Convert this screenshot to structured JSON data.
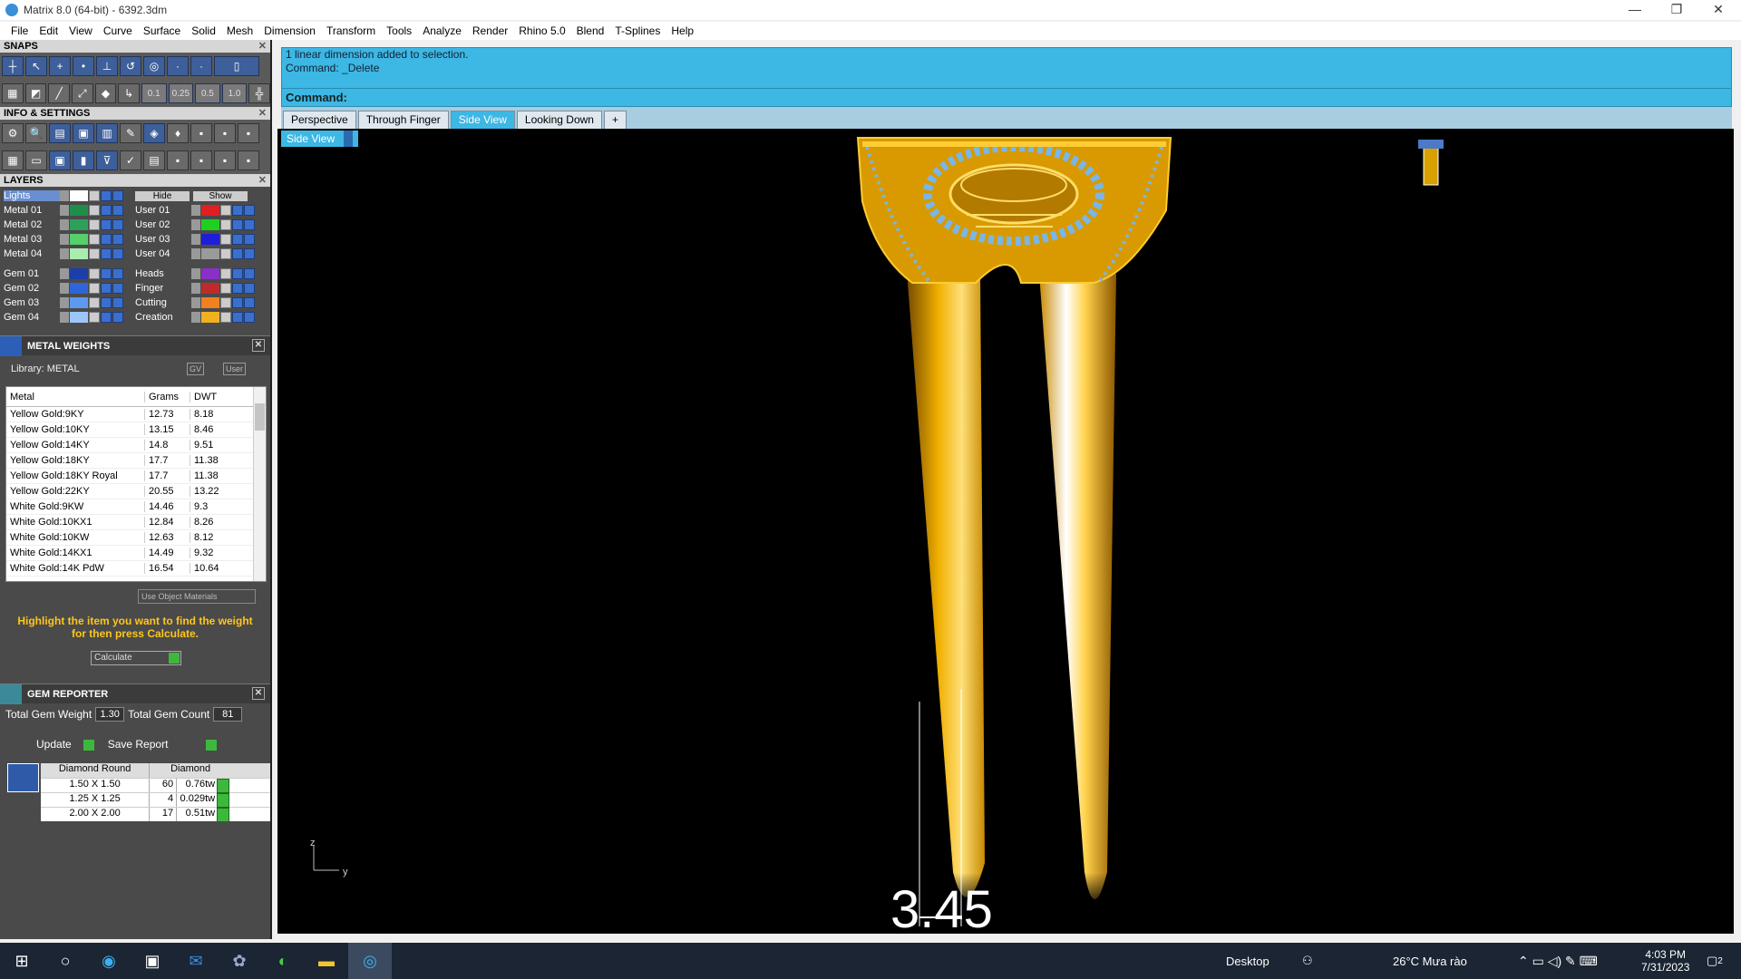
{
  "window": {
    "title": "Matrix 8.0 (64-bit) - 6392.3dm",
    "minimize": "—",
    "maximize": "❐",
    "close": "✕"
  },
  "menu": [
    "File",
    "Edit",
    "View",
    "Curve",
    "Surface",
    "Solid",
    "Mesh",
    "Dimension",
    "Transform",
    "Tools",
    "Analyze",
    "Render",
    "Rhino 5.0",
    "Blend",
    "T-Splines",
    "Help"
  ],
  "snaps": {
    "title": "SNAPS",
    "values": [
      "0.1",
      "0.25",
      "0.5",
      "1.0"
    ]
  },
  "info_settings": {
    "title": "INFO & SETTINGS"
  },
  "layers": {
    "title": "LAYERS",
    "lights": "Lights",
    "hide": "Hide",
    "show": "Show",
    "left": [
      {
        "name": "Metal 01",
        "color": "#1e8f4a"
      },
      {
        "name": "Metal 02",
        "color": "#2ea05a"
      },
      {
        "name": "Metal 03",
        "color": "#55d06a"
      },
      {
        "name": "Metal 04",
        "color": "#a8ecb0"
      },
      {
        "name": "Gem 01",
        "color": "#1a3fa8"
      },
      {
        "name": "Gem 02",
        "color": "#2e66d8"
      },
      {
        "name": "Gem 03",
        "color": "#5c9af0"
      },
      {
        "name": "Gem 04",
        "color": "#9cc6f8"
      }
    ],
    "right": [
      {
        "name": "User 01",
        "color": "#e02020"
      },
      {
        "name": "User 02",
        "color": "#20d020"
      },
      {
        "name": "User 03",
        "color": "#1e1ed8"
      },
      {
        "name": "User 04",
        "color": "#9a9a9a"
      },
      {
        "name": "Heads",
        "color": "#8a2fc8"
      },
      {
        "name": "Finger",
        "color": "#c02a2a"
      },
      {
        "name": "Cutting",
        "color": "#f08020"
      },
      {
        "name": "Creation",
        "color": "#f0b020"
      }
    ]
  },
  "metal_weights": {
    "title": "METAL WEIGHTS",
    "library": "Library: METAL",
    "gv": "GV",
    "user": "User",
    "columns": [
      "Metal",
      "Grams",
      "DWT"
    ],
    "rows": [
      [
        "Yellow Gold:9KY",
        "12.73",
        "8.18"
      ],
      [
        "Yellow Gold:10KY",
        "13.15",
        "8.46"
      ],
      [
        "Yellow Gold:14KY",
        "14.8",
        "9.51"
      ],
      [
        "Yellow Gold:18KY",
        "17.7",
        "11.38"
      ],
      [
        "Yellow Gold:18KY Royal",
        "17.7",
        "11.38"
      ],
      [
        "Yellow Gold:22KY",
        "20.55",
        "13.22"
      ],
      [
        "White Gold:9KW",
        "14.46",
        "9.3"
      ],
      [
        "White Gold:10KX1",
        "12.84",
        "8.26"
      ],
      [
        "White Gold:10KW",
        "12.63",
        "8.12"
      ],
      [
        "White Gold:14KX1",
        "14.49",
        "9.32"
      ],
      [
        "White Gold:14K PdW",
        "16.54",
        "10.64"
      ]
    ],
    "use_object_materials": "Use Object Materials",
    "hint": "Highlight the item you want to find the weight for then press Calculate.",
    "calculate": "Calculate"
  },
  "gem_reporter": {
    "title": "GEM REPORTER",
    "total_weight_label": "Total Gem Weight",
    "total_weight": "1.30",
    "total_count_label": "Total Gem Count",
    "total_count": "81",
    "update": "Update",
    "save_report": "Save Report",
    "columns": [
      "Diamond Round",
      "Diamond"
    ],
    "rows": [
      [
        "1.50 X 1.50",
        "60",
        "0.76tw"
      ],
      [
        "1.25 X 1.25",
        "4",
        "0.029tw"
      ],
      [
        "2.00 X 2.00",
        "17",
        "0.51tw"
      ]
    ]
  },
  "command": {
    "line1": "1 linear dimension added to selection.",
    "line2": "Command: _Delete",
    "prompt": "Command:"
  },
  "tabs": [
    "Perspective",
    "Through Finger",
    "Side View",
    "Looking Down",
    "+"
  ],
  "active_tab": "Side View",
  "viewport": {
    "label": "Side View",
    "dimension": "3.45",
    "axis_z": "z",
    "axis_y": "y"
  },
  "taskbar": {
    "desktop": "Desktop",
    "weather": "26°C  Mưa rào",
    "time": "4:03 PM",
    "date": "7/31/2023",
    "notifications": "2"
  }
}
